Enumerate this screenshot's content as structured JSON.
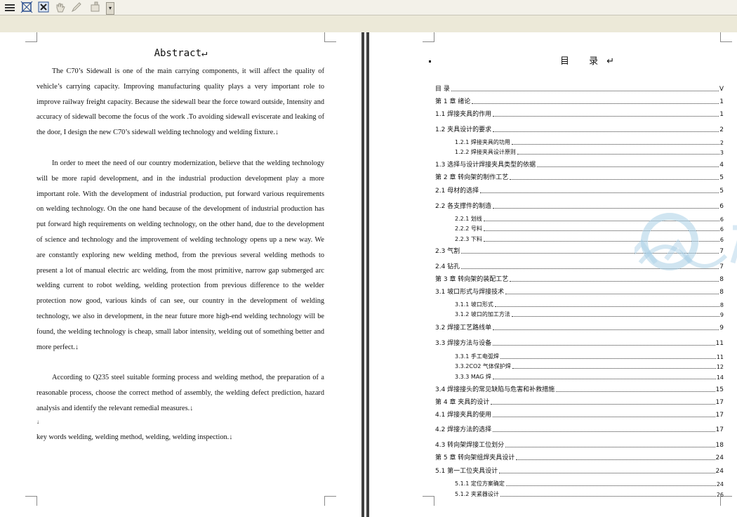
{
  "toolbar": {
    "buttons": [
      {
        "name": "menu-icon"
      },
      {
        "name": "select-frame-icon"
      },
      {
        "name": "close-frame-icon"
      },
      {
        "name": "hand-icon"
      },
      {
        "name": "pencil-icon"
      },
      {
        "name": "tool-icon"
      }
    ],
    "dropdown_glyph": "▾"
  },
  "abstract": {
    "title": "Abstract↵",
    "paragraphs": [
      "The C70’s Sidewall is one of the main carrying components, it will affect the quality of vehicle’s carrying capacity. Improving manufacturing quality plays a very important role to improve railway freight capacity. Because the sidewall bear the force toward outside, Intensity and accuracy of sidewall become the focus of the work .To avoiding sidewall eviscerate and leaking of the door, I design the new C70’s sidewall welding technology and welding fixture.↓",
      "In order to meet the need of our country modernization, believe that the welding technology will be more rapid development, and in the industrial production development play a more important role. With the development of industrial production, put forward various requirements on welding technology. On the one hand because of the development of industrial production has put forward high requirements on welding technology, on the other hand, due to the development of science and technology and the improvement of welding technology opens up a new way. We are constantly exploring new welding method, from the previous several welding methods to present a lot of manual electric arc welding, from the most primitive, narrow gap submerged arc welding current to robot welding, welding protection from previous difference to the welder protection now good, various kinds of can see, our country in the development of welding technology, we also in development, in the near future more high-end welding technology will be found, the welding technology is cheap, small labor intensity, welding out of something better and more perfect.↓",
      "According to Q235 steel suitable forming process and welding method, the preparation of a reasonable process, choose the correct method of assembly, the welding defect prediction, hazard analysis and identify the relevant remedial measures.↓"
    ],
    "blank_mark": "↓",
    "keywords": "key words    welding, welding method, welding, welding inspection.↓"
  },
  "toc": {
    "title": "目  录↵",
    "entries": [
      {
        "text": "目  录",
        "page": "V",
        "level": 0
      },
      {
        "text": "第 1 章   绪论",
        "page": "1",
        "level": 0
      },
      {
        "text": "1.1  焊接夹具的作用",
        "page": "1",
        "level": 0
      },
      {
        "text": "1.2  夹具设计的要求",
        "page": "2",
        "level": 0
      },
      {
        "text": "1.2.1 焊接夹具的功用",
        "page": "2",
        "level": 1
      },
      {
        "text": "1.2.2 焊接夹具设计原则",
        "page": "3",
        "level": 1
      },
      {
        "text": "1.3  选择与设计焊接夹具类型的依据",
        "page": "4",
        "level": 0
      },
      {
        "text": "第 2 章   转向架的制作工艺",
        "page": "5",
        "level": 0
      },
      {
        "text": "2.1  母材的选择",
        "page": "5",
        "level": 0
      },
      {
        "text": "2.2 各支撑件的制造",
        "page": "6",
        "level": 0
      },
      {
        "text": "2.2.1 划线",
        "page": "6",
        "level": 1
      },
      {
        "text": "2.2.2 号料",
        "page": "6",
        "level": 1
      },
      {
        "text": "2.2.3  下料",
        "page": "6",
        "level": 1
      },
      {
        "text": "2.3 气割",
        "page": "7",
        "level": 0
      },
      {
        "text": "2.4  钻孔",
        "page": "7",
        "level": 0
      },
      {
        "text": "第 3 章   转向架的装配工艺",
        "page": "8",
        "level": 0
      },
      {
        "text": "3.1 坡口形式与焊接技术",
        "page": "8",
        "level": 0
      },
      {
        "text": "3.1.1  坡口形式",
        "page": "8",
        "level": 1
      },
      {
        "text": "3.1.2  坡口的加工方法",
        "page": "9",
        "level": 1
      },
      {
        "text": "3.2  焊接工艺路线单",
        "page": "9",
        "level": 0
      },
      {
        "text": "3.3 焊接方法与设备",
        "page": "11",
        "level": 0
      },
      {
        "text": "3.3.1 手工电弧焊",
        "page": "11",
        "level": 1
      },
      {
        "text": "3.3.2CO2 气体保护焊",
        "page": "12",
        "level": 1
      },
      {
        "text": "3.3.3 MAG 焊",
        "page": "14",
        "level": 1
      },
      {
        "text": "3.4  焊接接头的常见缺陷与危害和补救措施",
        "page": "15",
        "level": 0
      },
      {
        "text": "第 4 章  夹具的设计",
        "page": "17",
        "level": 0
      },
      {
        "text": "4.1  焊接夹具的使用",
        "page": "17",
        "level": 0
      },
      {
        "text": "4.2   焊接方法的选择",
        "page": "17",
        "level": 0
      },
      {
        "text": "4.3    转向架焊接工位划分",
        "page": "18",
        "level": 0
      },
      {
        "text": "第 5 章    转向架组焊夹具设计",
        "page": "24",
        "level": 0
      },
      {
        "text": "5.1    第一工位夹具设计",
        "page": "24",
        "level": 0
      },
      {
        "text": "5.1.1  定位方案确定",
        "page": "24",
        "level": 1
      },
      {
        "text": "5.1.2    夹紧器设计",
        "page": "26",
        "level": 1
      }
    ]
  },
  "colors": {
    "toolbar_bg": "#f3f1e9",
    "ruler_band": "#ece9d8",
    "divider": "#404040",
    "watermark": "#a9cfe6"
  }
}
